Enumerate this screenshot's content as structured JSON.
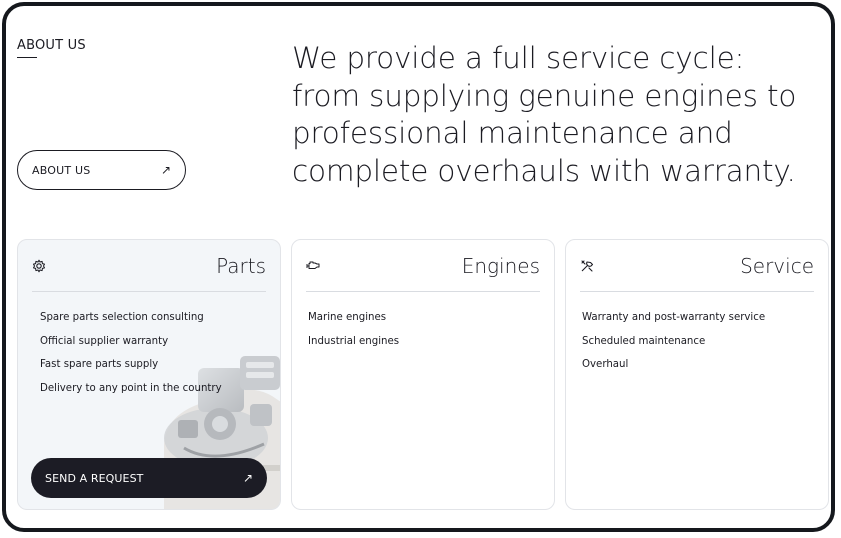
{
  "about": {
    "section_label": "ABOUT US",
    "button_label": "ABOUT US",
    "button_arrow": "↗"
  },
  "headline": {
    "lines": [
      "We provide a full service cycle:",
      "from supplying genuine engines to",
      "professional maintenance and",
      "complete overhauls with warranty."
    ]
  },
  "cards": [
    {
      "title": "Parts",
      "icon": "gear-icon",
      "items": [
        "Spare parts selection consulting",
        "Official supplier warranty",
        "Fast spare parts supply",
        "Delivery to any point in the country"
      ],
      "cta_label": "SEND A REQUEST",
      "cta_arrow": "↗"
    },
    {
      "title": "Engines",
      "icon": "engine-icon",
      "items": [
        "Marine engines",
        "Industrial engines"
      ]
    },
    {
      "title": "Service",
      "icon": "tools-icon",
      "items": [
        "Warranty and post-warranty service",
        "Scheduled maintenance",
        "Overhaul"
      ]
    }
  ],
  "colors": {
    "frame": "#15181d",
    "text": "#1b1b22",
    "card_border": "#e2e4e8",
    "parts_card_bg": "#f3f6f9",
    "cta_bg": "#1c1c25",
    "cta_text": "#ffffff"
  }
}
